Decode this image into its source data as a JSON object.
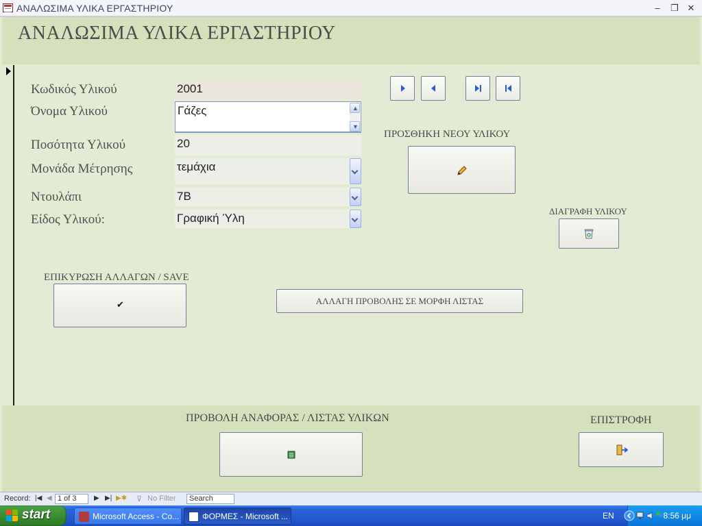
{
  "window": {
    "title": "ΑΝΑΛΩΣΙΜΑ ΥΛΙΚΑ ΕΡΓΑΣΤΗΡΙΟΥ",
    "minimize": "–",
    "restore": "❐",
    "close": "✕"
  },
  "form": {
    "header_title": "ΑΝΑΛΩΣΙΜΑ ΥΛΙΚΑ ΕΡΓΑΣΤΗΡΙΟΥ",
    "fields": {
      "code_label": "Κωδικός Υλικού",
      "code_value": "2001",
      "name_label": "Όνομα Υλικού",
      "name_value": "Γάζες",
      "quantity_label": "Ποσότητα Υλικού",
      "quantity_value": "20",
      "unit_label": "Μονάδα Μέτρησης",
      "unit_value": "τεμάχια",
      "cabinet_label": "Ντουλάπι",
      "cabinet_value": "7Β",
      "type_label": "Είδος Υλικού:",
      "type_value": "Γραφική Ύλη"
    },
    "buttons": {
      "add_new_caption": "ΠΡΟΣΘΗΚΗ ΝΕΟΥ ΥΛΙΚΟΥ",
      "delete_caption": "ΔΙΑΓΡΑΦΗ ΥΛΙΚΟΥ",
      "save_caption": "ΕΠΙΚΥΡΩΣΗ ΑΛΛΑΓΩΝ / SAVE",
      "save_glyph": "✔",
      "list_view_label": "ΑΛΛΑΓΗ ΠΡΟΒΟΛΗΣ ΣΕ ΜΟΡΦΗ ΛΙΣΤΑΣ",
      "report_caption": "ΠΡΟΒΟΛΗ ΑΝΑΦΟΡΑΣ / ΛΙΣΤΑΣ ΥΛΙΚΩΝ",
      "return_caption": "ΕΠΙΣΤΡΟΦΗ"
    }
  },
  "record_nav": {
    "record_label": "Record:",
    "position": "1 of 3",
    "filter_label": "No Filter",
    "search_placeholder": "Search"
  },
  "taskbar": {
    "start_label": "start",
    "tasks": [
      "Microsoft Access - Co...",
      "ΦΟΡΜΕΣ - Microsoft ..."
    ],
    "language": "EN",
    "time": "8:56 μμ"
  },
  "colors": {
    "form_background": "#e3ebd5",
    "header_background": "#d5e0bd",
    "nav_arrow": "#2a5bd7",
    "taskbar": "#2259d0",
    "start_button": "#37882f"
  },
  "icons": {
    "next_record": "next-record-icon",
    "previous_record": "previous-record-icon",
    "last_record": "last-record-icon",
    "first_record": "first-record-icon",
    "add": "pencil-icon",
    "delete": "recycle-bin-icon",
    "save": "checkmark-icon",
    "report": "report-icon",
    "return": "exit-door-icon"
  }
}
